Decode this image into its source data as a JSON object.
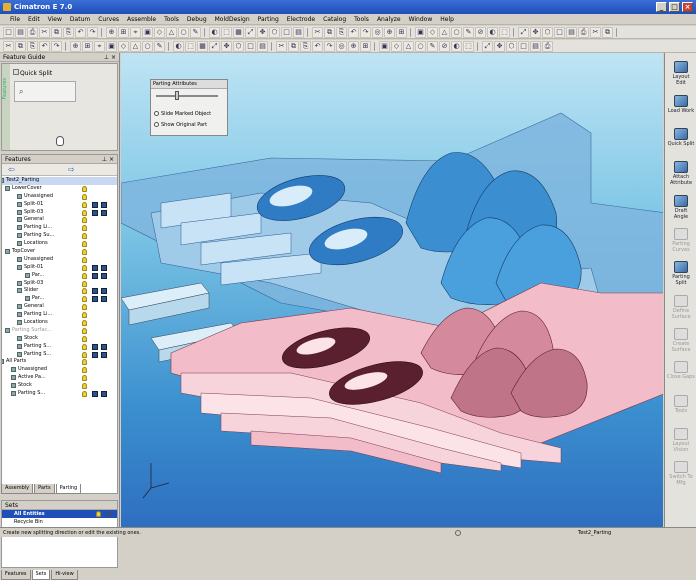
{
  "window": {
    "title": "Cimatron E 7.0"
  },
  "menu": [
    "File",
    "Edit",
    "View",
    "Datum",
    "Curves",
    "Assemble",
    "Tools",
    "Debug",
    "MoldDesign",
    "Parting",
    "Electrode",
    "Catalog",
    "Tools",
    "Analyze",
    "Window",
    "Help"
  ],
  "feature_guide": {
    "title": "Feature Guide",
    "vertical_label": "Features",
    "item_label": "Quick Split"
  },
  "features_panel": {
    "title": "Features"
  },
  "tree": [
    {
      "label": "Test2_Parting",
      "indent": 4,
      "sel": true
    },
    {
      "label": "LowerCover",
      "indent": 10
    },
    {
      "label": "Unassigned",
      "indent": 22
    },
    {
      "label": "Split-01",
      "indent": 22
    },
    {
      "label": "Split-03",
      "indent": 22
    },
    {
      "label": "General",
      "indent": 22
    },
    {
      "label": "Parting Li...",
      "indent": 22
    },
    {
      "label": "Parting Su...",
      "indent": 22
    },
    {
      "label": "Locations",
      "indent": 22
    },
    {
      "label": "TopCover",
      "indent": 10
    },
    {
      "label": "Unassigned",
      "indent": 22
    },
    {
      "label": "Split-01",
      "indent": 22
    },
    {
      "label": "Par...",
      "indent": 30
    },
    {
      "label": "Split-03",
      "indent": 22
    },
    {
      "label": "Slider",
      "indent": 22
    },
    {
      "label": "Par...",
      "indent": 30
    },
    {
      "label": "General",
      "indent": 22
    },
    {
      "label": "Parting Li...",
      "indent": 22
    },
    {
      "label": "Locations",
      "indent": 22
    },
    {
      "label": "Parting Surfac...",
      "indent": 10,
      "dim": true
    },
    {
      "label": "Stock",
      "indent": 22
    },
    {
      "label": "Parting S...",
      "indent": 22
    },
    {
      "label": "Parting S...",
      "indent": 22
    },
    {
      "label": "All Parts",
      "indent": 4
    },
    {
      "label": "Unassigned",
      "indent": 16
    },
    {
      "label": "Active Pa...",
      "indent": 16
    },
    {
      "label": "Stock",
      "indent": 16
    },
    {
      "label": "Parting S...",
      "indent": 16
    }
  ],
  "panel_tabs": [
    "Assembly",
    "Parts",
    "Parting"
  ],
  "sets": {
    "title": "Sets",
    "items": [
      "All Entities",
      "Recycle Bin"
    ]
  },
  "bottom_tabs": [
    "Features",
    "Sets",
    "Hi-view"
  ],
  "parting_attributes": {
    "title": "Parting Attributes",
    "opt1": "Slide Marked Object",
    "opt2": "Show Original Part"
  },
  "right_tools": [
    {
      "label": "Layout Edit",
      "dim": false
    },
    {
      "label": "Load Work",
      "dim": false
    },
    {
      "label": "Quick Split",
      "dim": false
    },
    {
      "label": "Attach Attribute",
      "dim": false
    },
    {
      "label": "Draft Angle",
      "dim": false
    },
    {
      "label": "Parting Curves",
      "dim": true
    },
    {
      "label": "Parting Split",
      "dim": false
    },
    {
      "label": "Define Surface",
      "dim": true
    },
    {
      "label": "Create Surface",
      "dim": true
    },
    {
      "label": "Close Gaps",
      "dim": true
    },
    {
      "label": "Tools",
      "dim": true
    },
    {
      "label": "Layout Vision",
      "dim": true
    },
    {
      "label": "Switch To Mfg",
      "dim": true
    }
  ],
  "status": {
    "left": "Create new splitting direction or edit the existing ones.",
    "right": "Test2_Parting"
  },
  "colors": {
    "upper_part": "#4a9fd8",
    "lower_part": "#f0b8c4",
    "viewport_top": "#bfe4f4",
    "viewport_bottom": "#2e6fc0"
  }
}
